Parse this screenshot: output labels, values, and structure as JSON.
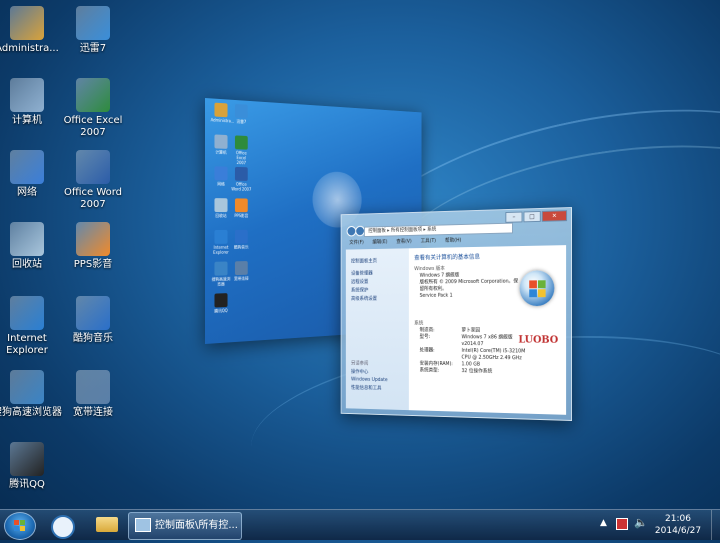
{
  "desktop_icons": [
    {
      "label": "Administra...",
      "color": "#d9a23a"
    },
    {
      "label": "迅雷7",
      "color": "#3a8ed9"
    },
    {
      "label": "计算机",
      "color": "#8fb0d0"
    },
    {
      "label": "Office Excel 2007",
      "color": "#2e8b3c"
    },
    {
      "label": "网络",
      "color": "#3a7ed9"
    },
    {
      "label": "Office Word 2007",
      "color": "#2b5ca8"
    },
    {
      "label": "回收站",
      "color": "#a9c6dc"
    },
    {
      "label": "PPS影音",
      "color": "#f08a2a"
    },
    {
      "label": "Internet Explorer",
      "color": "#2a7fd3"
    },
    {
      "label": "酷狗音乐",
      "color": "#2a6fc9"
    },
    {
      "label": "搜狗高速浏览器",
      "color": "#3a84c6"
    },
    {
      "label": "宽带连接",
      "color": "#5a7fa8"
    },
    {
      "label": "腾讯QQ",
      "color": "#222222"
    }
  ],
  "mini_desktop_icons": [
    {
      "label": "Administra..."
    },
    {
      "label": "迅雷7"
    },
    {
      "label": "计算机"
    },
    {
      "label": "Office Excel 2007"
    },
    {
      "label": "网络"
    },
    {
      "label": "Office Word 2007"
    },
    {
      "label": "回收站"
    },
    {
      "label": "PPS影音"
    },
    {
      "label": "Internet Explorer"
    },
    {
      "label": "酷狗音乐"
    },
    {
      "label": "搜狗高速浏览器"
    },
    {
      "label": "宽带连接"
    },
    {
      "label": "腾讯QQ"
    }
  ],
  "control_panel_window": {
    "address": "控制面板 ▸ 所有控制面板项 ▸ 系统",
    "menu": [
      "文件(F)",
      "编辑(E)",
      "查看(V)",
      "工具(T)",
      "帮助(H)"
    ],
    "left_links": [
      "控制面板主页",
      "设备管理器",
      "远程设置",
      "系统保护",
      "高级系统设置"
    ],
    "left_bottom_title": "另请参阅",
    "left_bottom_links": [
      "操作中心",
      "Windows Update",
      "性能信息和工具"
    ],
    "heading": "查看有关计算机的基本信息",
    "edition_title": "Windows 版本",
    "edition_lines": [
      "Windows 7 旗舰版",
      "版权所有 © 2009 Microsoft Corporation。保留所有权利。",
      "Service Pack 1"
    ],
    "system_title": "系统",
    "system_rows": [
      {
        "k": "制造商:",
        "v": "萝卜家园"
      },
      {
        "k": "型号:",
        "v": "Windows 7 x86 旗舰版 v2014.07"
      },
      {
        "k": "处理器:",
        "v": "Intel(R) Core(TM) i5-3210M CPU @ 2.50GHz 2.49 GHz"
      },
      {
        "k": "安装内存(RAM):",
        "v": "1.00 GB"
      },
      {
        "k": "系统类型:",
        "v": "32 位操作系统"
      }
    ],
    "oem_logo": "LUOBO"
  },
  "taskbar": {
    "task_label": "控制面板\\所有控...",
    "time": "21:06",
    "date": "2014/6/27"
  }
}
